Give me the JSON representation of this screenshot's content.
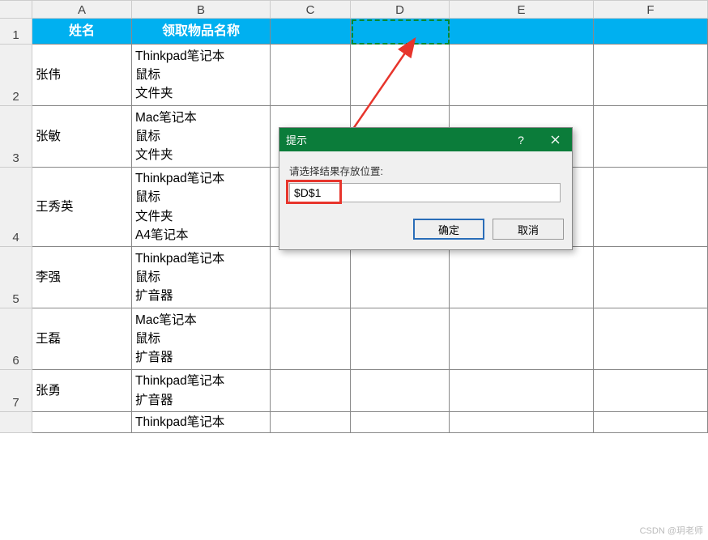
{
  "columns": [
    "A",
    "B",
    "C",
    "D",
    "E",
    "F"
  ],
  "headers": {
    "name": "姓名",
    "items": "领取物品名称"
  },
  "rows": [
    {
      "num": "1"
    },
    {
      "num": "2",
      "name": "张伟",
      "items": "Thinkpad笔记本\n鼠标\n文件夹"
    },
    {
      "num": "3",
      "name": "张敏",
      "items": "Mac笔记本\n鼠标\n文件夹"
    },
    {
      "num": "4",
      "name": "王秀英",
      "items": "Thinkpad笔记本\n鼠标\n文件夹\nA4笔记本"
    },
    {
      "num": "5",
      "name": "李强",
      "items": "Thinkpad笔记本\n鼠标\n扩音器"
    },
    {
      "num": "6",
      "name": "王磊",
      "items": "Mac笔记本\n鼠标\n扩音器"
    },
    {
      "num": "7",
      "name": "张勇",
      "items": "Thinkpad笔记本\n扩音器"
    },
    {
      "num": "",
      "name": "",
      "items": "Thinkpad笔记本"
    }
  ],
  "dialog": {
    "title": "提示",
    "label": "请选择结果存放位置:",
    "input_value": "$D$1",
    "ok": "确定",
    "cancel": "取消"
  },
  "watermark": "CSDN @玥老师"
}
